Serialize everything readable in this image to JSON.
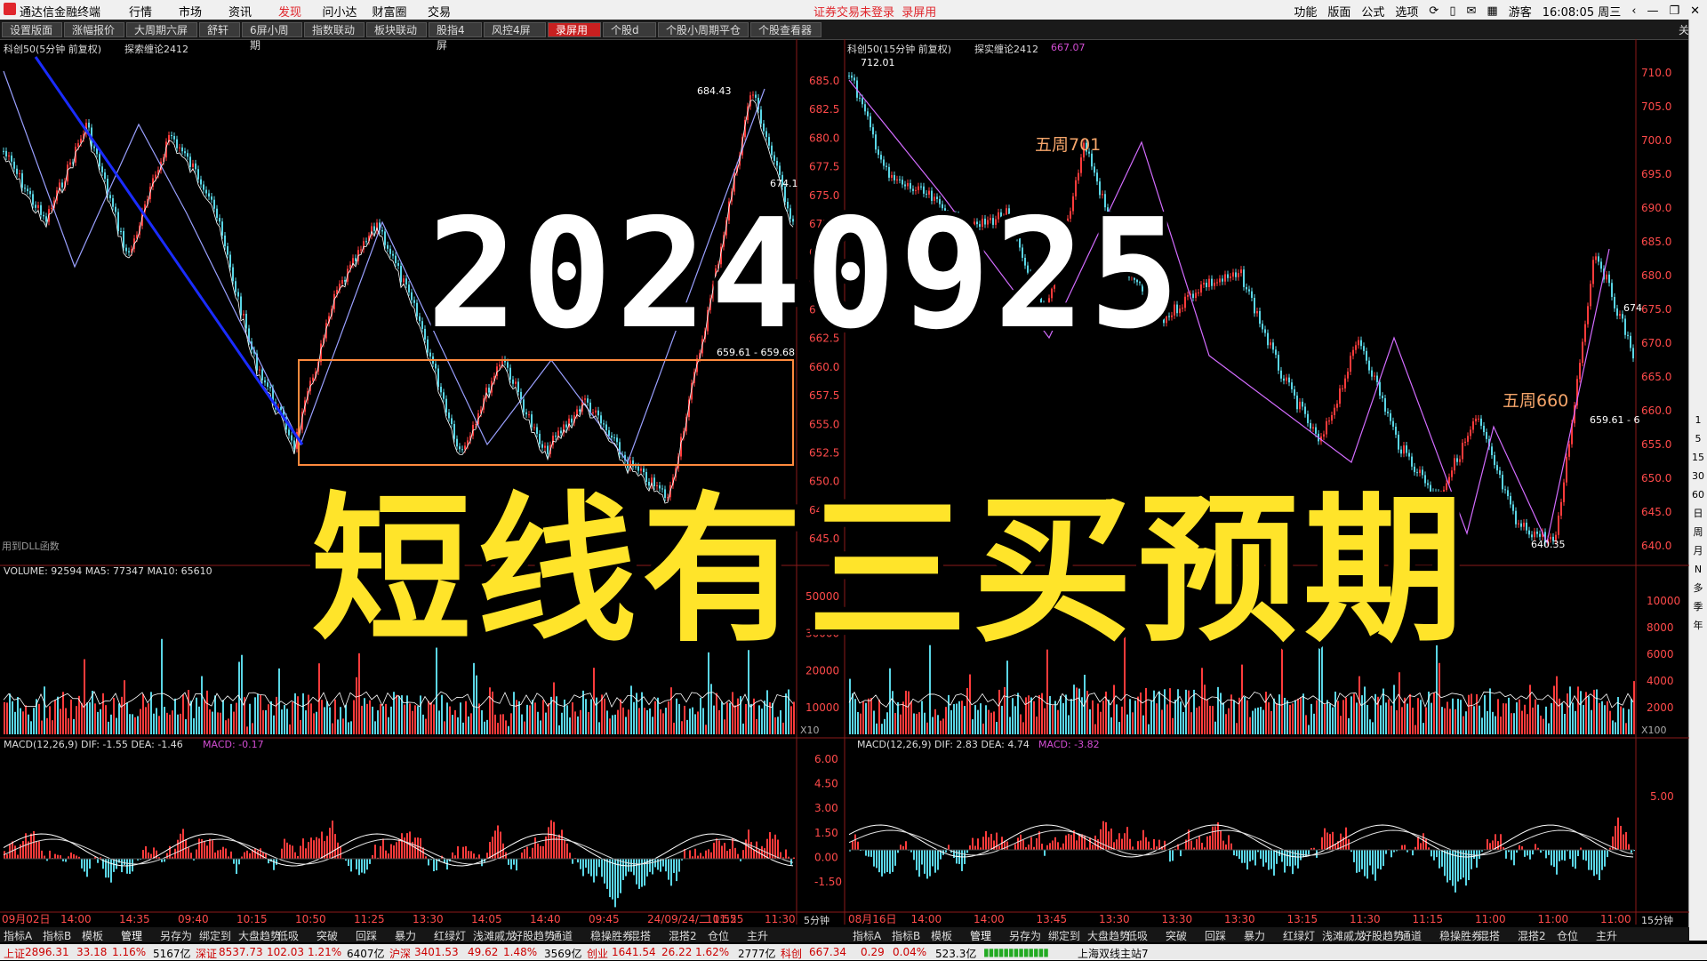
{
  "app": {
    "title": "通达信金融终端",
    "clock": "16:08:05 周三",
    "user": "游客"
  },
  "menu": [
    {
      "label": "行情"
    },
    {
      "label": "市场"
    },
    {
      "label": "资讯"
    },
    {
      "label": "发现"
    },
    {
      "label": "问小达"
    },
    {
      "label": "财富圈"
    },
    {
      "label": "交易"
    }
  ],
  "notice": {
    "a": "证券交易未登录",
    "b": "录屏用"
  },
  "right_menu": [
    {
      "label": "功能"
    },
    {
      "label": "版面"
    },
    {
      "label": "公式"
    },
    {
      "label": "选项"
    }
  ],
  "tabs": [
    {
      "label": "设置版面"
    },
    {
      "label": "涨幅报价"
    },
    {
      "label": "大周期六屏"
    },
    {
      "label": "舒轩"
    },
    {
      "label": "6屏小周期"
    },
    {
      "label": "指数联动"
    },
    {
      "label": "板块联动"
    },
    {
      "label": "股指4屏"
    },
    {
      "label": "风控4屏"
    },
    {
      "label": "录屏用"
    },
    {
      "label": "个股d"
    },
    {
      "label": "个股小周期平仓"
    },
    {
      "label": "个股查看器"
    }
  ],
  "close_label": "关闭",
  "left_chart": {
    "header": "科创50(5分钟 前复权)",
    "indicator": "探索缠论2412",
    "price_ticks": [
      "685.0",
      "682.5",
      "680.0",
      "677.5",
      "675.0",
      "672.5",
      "670.0",
      "667.5",
      "665.0",
      "662.5",
      "660.0",
      "657.5",
      "655.0",
      "652.5",
      "650.0",
      "647.5",
      "645.0"
    ],
    "high_label": "684.43",
    "last_label": "674.1",
    "box_label": "659.61 - 659.68",
    "dll_note": "用到DLL函数",
    "volume_header": "VOLUME: 92594  MA5: 77347  MA10: 65610",
    "volume_ticks": [
      "50000",
      "30000",
      "20000",
      "10000"
    ],
    "volume_unit": "X10",
    "macd_header": "MACD(12,26,9)  DIF: -1.55  DEA: -1.46",
    "macd_value": "MACD: -0.17",
    "macd_ticks": [
      "6.00",
      "4.50",
      "3.00",
      "1.50",
      "0.00",
      "-1.50"
    ],
    "time_labels": [
      "09月02日",
      "14:00",
      "14:35",
      "09:40",
      "10:15",
      "10:50",
      "11:25",
      "13:30",
      "14:05",
      "14:40",
      "09:45",
      "24/09/24/二 11:25",
      "10:55",
      "11:30"
    ],
    "period": "5分钟"
  },
  "right_chart": {
    "header": "科创50(15分钟 前复权)",
    "indicator": "探实缠论2412",
    "indicator_value": "667.07",
    "price_ticks": [
      "710.0",
      "705.0",
      "700.0",
      "695.0",
      "690.0",
      "685.0",
      "680.0",
      "675.0",
      "670.0",
      "665.0",
      "660.0",
      "655.0",
      "650.0",
      "645.0",
      "640.0"
    ],
    "high_label": "712.01",
    "low_label": "640.35",
    "box_label": "659.61 - 6",
    "last_label": "674",
    "annotation1": "五周701",
    "annotation2": "五周660",
    "volume_header": "VOLUME: 25847",
    "volume_ticks": [
      "10000",
      "8000",
      "6000",
      "4000",
      "2000"
    ],
    "volume_unit": "X100",
    "macd_header": "MACD(12,26,9)  DIF: 2.83  DEA: 4.74",
    "macd_value": "MACD: -3.82",
    "macd_ticks": [
      "5.00"
    ],
    "time_labels": [
      "08月16日",
      "14:00",
      "14:00",
      "13:45",
      "13:30",
      "13:30",
      "13:30",
      "13:15",
      "11:30",
      "11:15",
      "11:00",
      "11:00",
      "11:00"
    ],
    "period": "15分钟"
  },
  "overlay": {
    "date": "20240925",
    "title": "短线有三买预期"
  },
  "indicator_tabs": [
    "指标A",
    "指标B",
    "模板",
    "管理",
    "另存为",
    "绑定到",
    "大盘趋势",
    "低吸",
    "突破",
    "回踩",
    "暴力",
    "红绿灯",
    "浅滩戚龙",
    "好股趋势",
    "通道",
    "稳操胜券",
    "混搭",
    "混搭2",
    "仓位",
    "主升"
  ],
  "status_bar": {
    "sh": {
      "name": "上证",
      "price": "2896.31",
      "chg": "33.18",
      "pct": "1.16%",
      "amt": "5167亿"
    },
    "sz": {
      "name": "深证",
      "price": "8537.73",
      "chg": "102.03",
      "pct": "1.21%",
      "amt": "6407亿"
    },
    "hs": {
      "name": "沪深",
      "price": "3401.53",
      "chg": "49.62",
      "pct": "1.48%",
      "amt": "3569亿"
    },
    "cy": {
      "name": "创业",
      "price": "1641.54",
      "chg": "26.22",
      "pct": "1.62%",
      "amt": "2777亿"
    },
    "kc": {
      "name": "科创",
      "price": "667.34",
      "chg": "0.29",
      "pct": "0.04%",
      "amt": "523.3亿"
    },
    "server": "上海双线主站7"
  },
  "sidebar_items": [
    "1",
    "5",
    "15",
    "30",
    "60",
    "日",
    "周",
    "月",
    "N",
    "多",
    "季",
    "年"
  ]
}
